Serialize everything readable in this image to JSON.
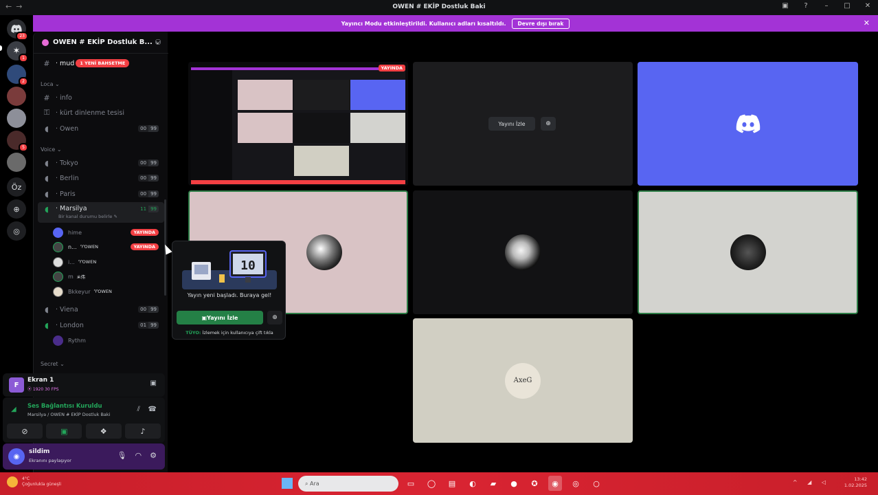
{
  "window": {
    "title": "OWEN # EKİP Dostluk Baki",
    "nav": [
      "←",
      "→"
    ],
    "controls": [
      "▣",
      "?",
      "–",
      "□",
      "✕"
    ]
  },
  "banner": {
    "text": "Yayıncı Modu etkinleştirildi. Kullanıcı adları kısaltıldı.",
    "button": "Devre dışı bırak",
    "close": "✕"
  },
  "rail": {
    "dm_badge": "23",
    "servers": [
      {
        "badge": "1"
      },
      {
        "badge": "2"
      },
      {
        "badge": ""
      },
      {
        "badge": ""
      },
      {
        "badge": "5"
      },
      {
        "badge": ""
      }
    ],
    "text_server": "Öz"
  },
  "guild": {
    "name": "OWEN # EKİP Dostluk B...",
    "chevron": "⌄"
  },
  "channels": {
    "top": {
      "name": "mud",
      "mention": "1 YENİ BAHSETME"
    },
    "categories": [
      "Loca",
      "Voice",
      "Secret"
    ],
    "loca": [
      {
        "name": "info",
        "icon": "#"
      },
      {
        "name": "kürt dinlenme tesisi",
        "icon": "🔒"
      },
      {
        "name": "Owen",
        "icon": "◖",
        "count": [
          "00",
          "99"
        ]
      }
    ],
    "voice": [
      {
        "name": "Tokyo",
        "count": [
          "00",
          "99"
        ]
      },
      {
        "name": "Berlin",
        "count": [
          "00",
          "99"
        ]
      },
      {
        "name": "Paris",
        "count": [
          "00",
          "99"
        ]
      }
    ],
    "active": {
      "name": "Marsilya",
      "count": [
        "11",
        "99"
      ],
      "status": "Bir kanal durumu belirle ✎"
    },
    "users": [
      {
        "name": "hime",
        "tag": "",
        "live": "YAYINDA"
      },
      {
        "name": "n...",
        "tag": "♈OWEN",
        "live": "YAYINDA"
      },
      {
        "name": "i...",
        "tag": "♈OWEN",
        "live": ""
      },
      {
        "name": "m",
        "tag": "ӝ伟",
        "live": ""
      },
      {
        "name": "Bkkeyur",
        "tag": "♈OWEN",
        "live": ""
      }
    ],
    "after": [
      {
        "name": "Viena",
        "count": [
          "00",
          "99"
        ]
      },
      {
        "name": "London",
        "count": [
          "01",
          "99"
        ]
      }
    ],
    "bot": {
      "name": "Rythm"
    }
  },
  "stream_panel": {
    "icon_letter": "F",
    "title": "Ekran 1",
    "subtitle": "⦿ 1920 30 FPS"
  },
  "voice_panel": {
    "title": "Ses Bağlantısı Kuruldu",
    "subtitle": "Marsilya / OWEN # EKİP Dostluk Baki"
  },
  "user_panel": {
    "name": "sildim",
    "status": "Ekranını paylaşıyor"
  },
  "grid": {
    "live_chip": "YAYINDA",
    "watch_label": "Yayını İzle",
    "avatar_text": "AxeG"
  },
  "popup": {
    "message": "Yayın yeni başladı. Buraya gel!",
    "button": "Yayını İzle",
    "tip_label": "TÜYO:",
    "tip_text": " İzlemek için kullanıcıya çift tıkla",
    "art_number": "10"
  },
  "taskbar": {
    "weather_line1": "4°C",
    "weather_line2": "Çoğunlukla güneşli",
    "search_placeholder": "Ara",
    "time": "13:42",
    "date": "1.02.2025"
  },
  "colors": {
    "accent": "#a333d6",
    "discord_blurple": "#5865f2",
    "online": "#23a55a",
    "live": "#f23f43",
    "taskbar": "#d92432"
  }
}
